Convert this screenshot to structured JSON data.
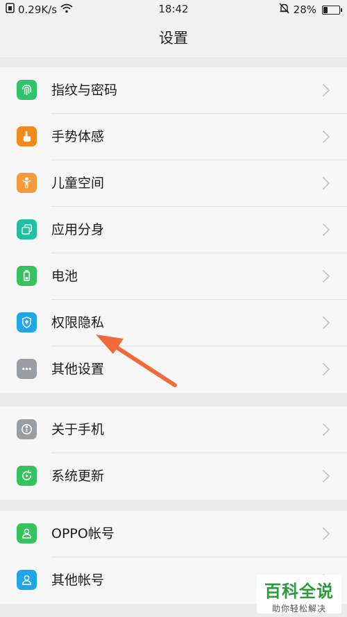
{
  "status_bar": {
    "speed": "0.29K/s",
    "time": "18:42",
    "battery_percent": "28%",
    "battery_level": 0.28,
    "icons": [
      "sim-icon",
      "wifi-icon",
      "alarm-muted-icon",
      "battery-icon"
    ]
  },
  "header": {
    "title": "设置"
  },
  "groups": [
    {
      "items": [
        {
          "label": "指纹与密码",
          "icon": "fingerprint-icon",
          "color": "#2fc36a"
        },
        {
          "label": "手势体感",
          "icon": "gesture-hand-icon",
          "color": "#f08a1c"
        },
        {
          "label": "儿童空间",
          "icon": "child-icon",
          "color": "#f59a3a"
        },
        {
          "label": "应用分身",
          "icon": "app-clone-icon",
          "color": "#20c0a0"
        },
        {
          "label": "电池",
          "icon": "battery-icon",
          "color": "#36c35e"
        },
        {
          "label": "权限隐私",
          "icon": "shield-icon",
          "color": "#1fa6e8"
        },
        {
          "label": "其他设置",
          "icon": "more-dots-icon",
          "color": "#9a9da2"
        }
      ]
    },
    {
      "items": [
        {
          "label": "关于手机",
          "icon": "info-icon",
          "color": "#9a9da2"
        },
        {
          "label": "系统更新",
          "icon": "update-icon",
          "color": "#36c35e"
        }
      ]
    },
    {
      "items": [
        {
          "label": "OPPO帐号",
          "icon": "user-icon",
          "color": "#36c35e"
        },
        {
          "label": "其他帐号",
          "icon": "user-icon",
          "color": "#1fa6e8"
        }
      ]
    }
  ],
  "watermark": {
    "title": "百科全说",
    "subtitle": "助你轻松解决"
  },
  "annotation": {
    "color": "#f26a3a"
  }
}
